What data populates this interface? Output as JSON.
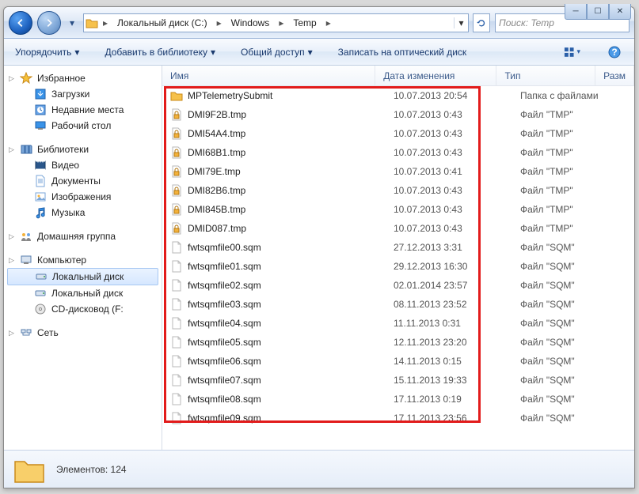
{
  "breadcrumb": {
    "seg1": "Локальный диск (C:)",
    "seg2": "Windows",
    "seg3": "Temp"
  },
  "search": {
    "placeholder": "Поиск: Temp"
  },
  "toolbar": {
    "organize": "Упорядочить",
    "addlib": "Добавить в библиотеку",
    "share": "Общий доступ",
    "burn": "Записать на оптический диск"
  },
  "sidebar": {
    "fav_head": "Избранное",
    "fav": [
      "Загрузки",
      "Недавние места",
      "Рабочий стол"
    ],
    "lib_head": "Библиотеки",
    "lib": [
      "Видео",
      "Документы",
      "Изображения",
      "Музыка"
    ],
    "home_head": "Домашняя группа",
    "comp_head": "Компьютер",
    "comp": [
      "Локальный диск",
      "Локальный диск",
      "CD-дисковод (F:"
    ],
    "net_head": "Сеть"
  },
  "columns": {
    "name": "Имя",
    "date": "Дата изменения",
    "type": "Тип",
    "size": "Разм"
  },
  "files": [
    {
      "icon": "folder",
      "name": "MPTelemetrySubmit",
      "date": "10.07.2013 20:54",
      "type": "Папка с файлами"
    },
    {
      "icon": "lock",
      "name": "DMI9F2B.tmp",
      "date": "10.07.2013 0:43",
      "type": "Файл \"TMP\""
    },
    {
      "icon": "lock",
      "name": "DMI54A4.tmp",
      "date": "10.07.2013 0:43",
      "type": "Файл \"TMP\""
    },
    {
      "icon": "lock",
      "name": "DMI68B1.tmp",
      "date": "10.07.2013 0:43",
      "type": "Файл \"TMP\""
    },
    {
      "icon": "lock",
      "name": "DMI79E.tmp",
      "date": "10.07.2013 0:41",
      "type": "Файл \"TMP\""
    },
    {
      "icon": "lock",
      "name": "DMI82B6.tmp",
      "date": "10.07.2013 0:43",
      "type": "Файл \"TMP\""
    },
    {
      "icon": "lock",
      "name": "DMI845B.tmp",
      "date": "10.07.2013 0:43",
      "type": "Файл \"TMP\""
    },
    {
      "icon": "lock",
      "name": "DMID087.tmp",
      "date": "10.07.2013 0:43",
      "type": "Файл \"TMP\""
    },
    {
      "icon": "file",
      "name": "fwtsqmfile00.sqm",
      "date": "27.12.2013 3:31",
      "type": "Файл \"SQM\""
    },
    {
      "icon": "file",
      "name": "fwtsqmfile01.sqm",
      "date": "29.12.2013 16:30",
      "type": "Файл \"SQM\""
    },
    {
      "icon": "file",
      "name": "fwtsqmfile02.sqm",
      "date": "02.01.2014 23:57",
      "type": "Файл \"SQM\""
    },
    {
      "icon": "file",
      "name": "fwtsqmfile03.sqm",
      "date": "08.11.2013 23:52",
      "type": "Файл \"SQM\""
    },
    {
      "icon": "file",
      "name": "fwtsqmfile04.sqm",
      "date": "11.11.2013 0:31",
      "type": "Файл \"SQM\""
    },
    {
      "icon": "file",
      "name": "fwtsqmfile05.sqm",
      "date": "12.11.2013 23:20",
      "type": "Файл \"SQM\""
    },
    {
      "icon": "file",
      "name": "fwtsqmfile06.sqm",
      "date": "14.11.2013 0:15",
      "type": "Файл \"SQM\""
    },
    {
      "icon": "file",
      "name": "fwtsqmfile07.sqm",
      "date": "15.11.2013 19:33",
      "type": "Файл \"SQM\""
    },
    {
      "icon": "file",
      "name": "fwtsqmfile08.sqm",
      "date": "17.11.2013 0:19",
      "type": "Файл \"SQM\""
    },
    {
      "icon": "file",
      "name": "fwtsqmfile09.sqm",
      "date": "17.11.2013 23:56",
      "type": "Файл \"SQM\""
    }
  ],
  "status": {
    "text": "Элементов: 124"
  }
}
